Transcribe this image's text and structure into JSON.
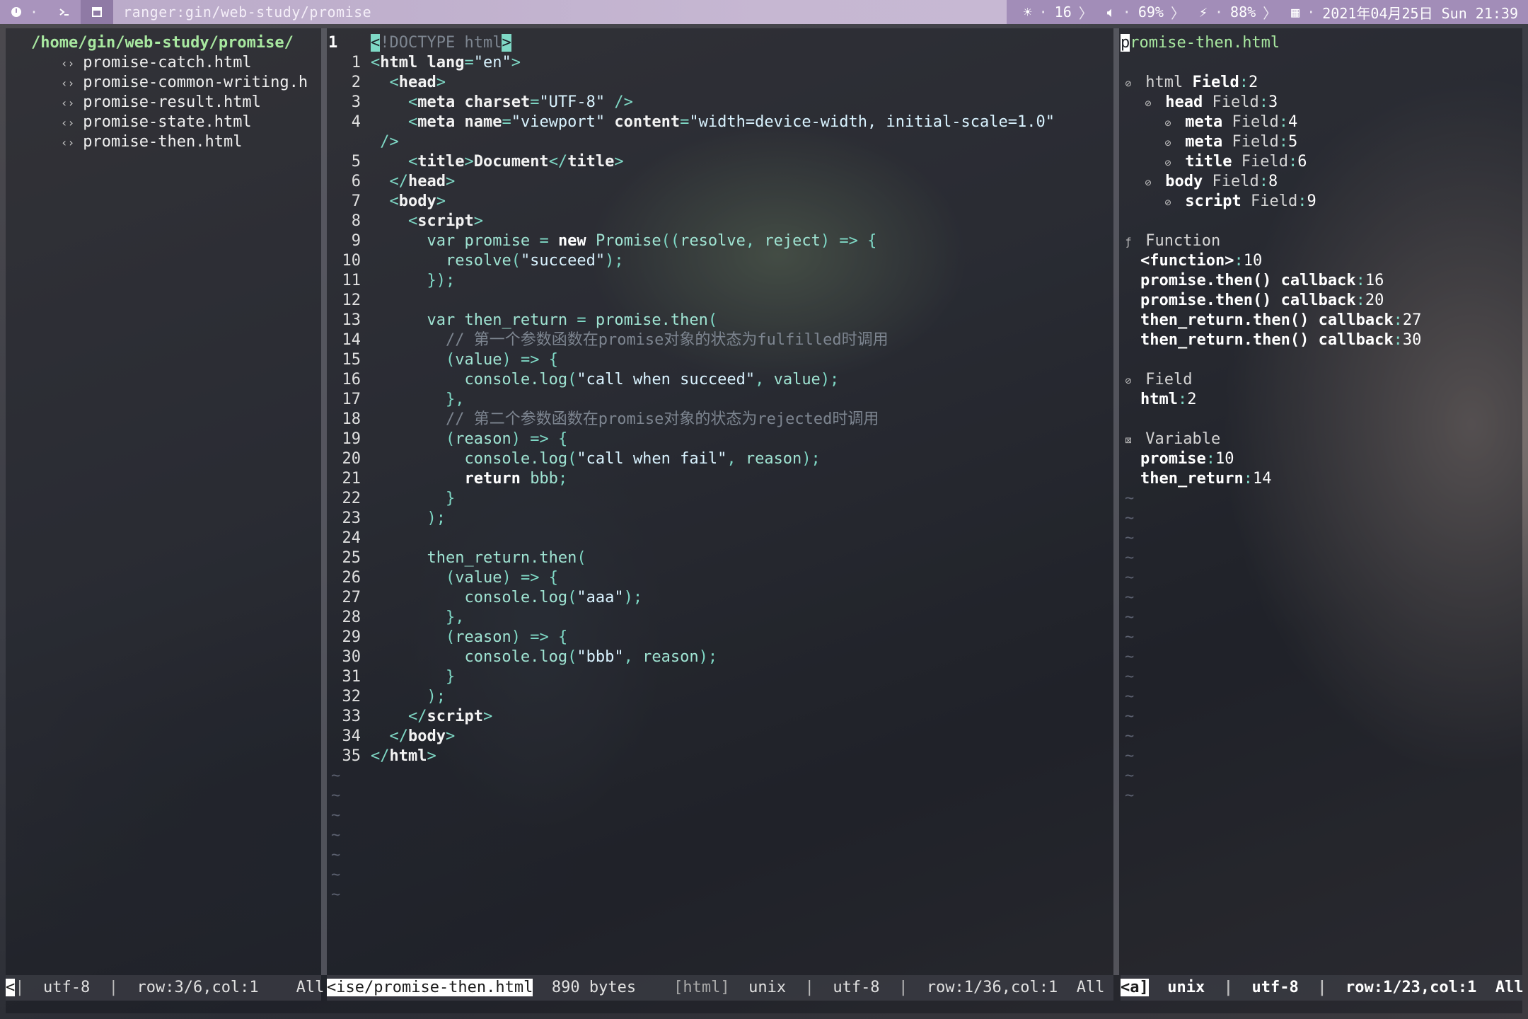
{
  "topbar": {
    "left_icons": [
      "circle-dot-icon",
      "terminal-icon",
      "window-icon"
    ],
    "title": "ranger:gin/web-study/promise",
    "brightness": "16",
    "volume": "69%",
    "battery": "88%",
    "datetime": "2021年04月25日 Sun 21:39"
  },
  "files": {
    "path": "/home/gin/web-study/promise/",
    "items": [
      "promise-catch.html",
      "promise-common-writing.h",
      "promise-result.html",
      "promise-state.html",
      "promise-then.html"
    ]
  },
  "code": {
    "current_line": "1",
    "doctype": "!DOCTYPE html",
    "comment1": "// 第一个参数函数在promise对象的状态为fulfilled时调用",
    "comment2": "// 第二个参数函数在promise对象的状态为rejected时调用"
  },
  "outline": {
    "filename": "promise-then.html",
    "tree": [
      {
        "indent": 0,
        "icon": "field-icon",
        "name": "html",
        "kind": "Field",
        "num": "2"
      },
      {
        "indent": 1,
        "icon": "field-icon",
        "name": "head",
        "kind": "Field",
        "num": "3"
      },
      {
        "indent": 2,
        "icon": "field-icon",
        "name": "meta",
        "kind": "Field",
        "num": "4"
      },
      {
        "indent": 2,
        "icon": "field-icon",
        "name": "meta",
        "kind": "Field",
        "num": "5"
      },
      {
        "indent": 2,
        "icon": "field-icon",
        "name": "title",
        "kind": "Field",
        "num": "6"
      },
      {
        "indent": 1,
        "icon": "field-icon",
        "name": "body",
        "kind": "Field",
        "num": "8"
      },
      {
        "indent": 2,
        "icon": "field-icon",
        "name": "script",
        "kind": "Field",
        "num": "9"
      }
    ],
    "groups": [
      {
        "title": "Function",
        "icon": "function-icon",
        "items": [
          {
            "name": "<function>",
            "num": "10"
          },
          {
            "name": "promise.then() callback",
            "num": "16"
          },
          {
            "name": "promise.then() callback",
            "num": "20"
          },
          {
            "name": "then_return.then() callback",
            "num": "27"
          },
          {
            "name": "then_return.then() callback",
            "num": "30"
          }
        ]
      },
      {
        "title": "Field",
        "icon": "field-icon",
        "items": [
          {
            "name": "html",
            "num": "2"
          }
        ]
      },
      {
        "title": "Variable",
        "icon": "variable-icon",
        "items": [
          {
            "name": "promise",
            "num": "10"
          },
          {
            "name": "then_return",
            "num": "14"
          }
        ]
      }
    ]
  },
  "status": {
    "files": {
      "mode": "<",
      "enc": "utf-8",
      "pos": "row:3/6,col:1",
      "scroll": "All"
    },
    "code": {
      "file": "<ise/promise-then.html",
      "size": "890 bytes",
      "ft": "[html]",
      "ff": "unix",
      "enc": "utf-8",
      "pos": "row:1/36,col:1",
      "scroll": "All"
    },
    "outline": {
      "mode": "<a]",
      "ff": "unix",
      "enc": "utf-8",
      "pos": "row:1/23,col:1",
      "scroll": "All"
    }
  }
}
